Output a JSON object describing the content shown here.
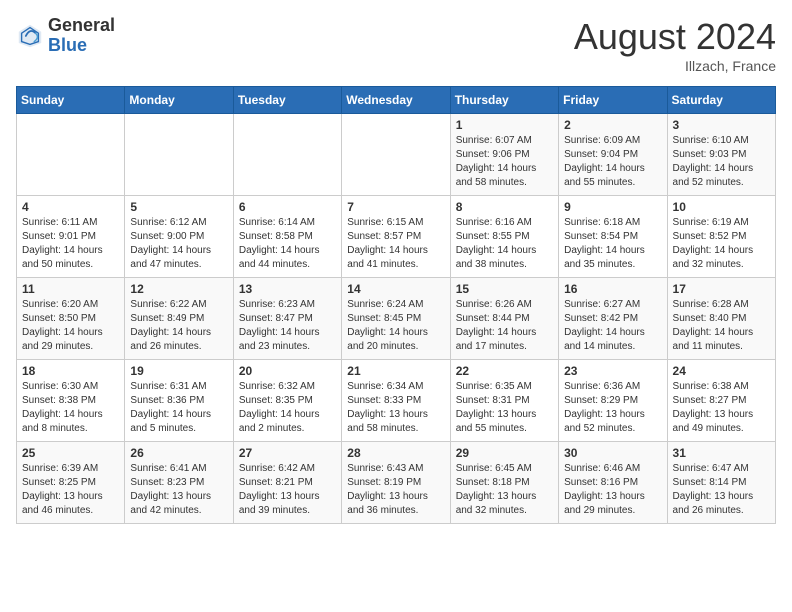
{
  "header": {
    "logo_general": "General",
    "logo_blue": "Blue",
    "month_title": "August 2024",
    "subtitle": "Illzach, France"
  },
  "days_of_week": [
    "Sunday",
    "Monday",
    "Tuesday",
    "Wednesday",
    "Thursday",
    "Friday",
    "Saturday"
  ],
  "weeks": [
    [
      {
        "day": "",
        "info": ""
      },
      {
        "day": "",
        "info": ""
      },
      {
        "day": "",
        "info": ""
      },
      {
        "day": "",
        "info": ""
      },
      {
        "day": "1",
        "info": "Sunrise: 6:07 AM\nSunset: 9:06 PM\nDaylight: 14 hours\nand 58 minutes."
      },
      {
        "day": "2",
        "info": "Sunrise: 6:09 AM\nSunset: 9:04 PM\nDaylight: 14 hours\nand 55 minutes."
      },
      {
        "day": "3",
        "info": "Sunrise: 6:10 AM\nSunset: 9:03 PM\nDaylight: 14 hours\nand 52 minutes."
      }
    ],
    [
      {
        "day": "4",
        "info": "Sunrise: 6:11 AM\nSunset: 9:01 PM\nDaylight: 14 hours\nand 50 minutes."
      },
      {
        "day": "5",
        "info": "Sunrise: 6:12 AM\nSunset: 9:00 PM\nDaylight: 14 hours\nand 47 minutes."
      },
      {
        "day": "6",
        "info": "Sunrise: 6:14 AM\nSunset: 8:58 PM\nDaylight: 14 hours\nand 44 minutes."
      },
      {
        "day": "7",
        "info": "Sunrise: 6:15 AM\nSunset: 8:57 PM\nDaylight: 14 hours\nand 41 minutes."
      },
      {
        "day": "8",
        "info": "Sunrise: 6:16 AM\nSunset: 8:55 PM\nDaylight: 14 hours\nand 38 minutes."
      },
      {
        "day": "9",
        "info": "Sunrise: 6:18 AM\nSunset: 8:54 PM\nDaylight: 14 hours\nand 35 minutes."
      },
      {
        "day": "10",
        "info": "Sunrise: 6:19 AM\nSunset: 8:52 PM\nDaylight: 14 hours\nand 32 minutes."
      }
    ],
    [
      {
        "day": "11",
        "info": "Sunrise: 6:20 AM\nSunset: 8:50 PM\nDaylight: 14 hours\nand 29 minutes."
      },
      {
        "day": "12",
        "info": "Sunrise: 6:22 AM\nSunset: 8:49 PM\nDaylight: 14 hours\nand 26 minutes."
      },
      {
        "day": "13",
        "info": "Sunrise: 6:23 AM\nSunset: 8:47 PM\nDaylight: 14 hours\nand 23 minutes."
      },
      {
        "day": "14",
        "info": "Sunrise: 6:24 AM\nSunset: 8:45 PM\nDaylight: 14 hours\nand 20 minutes."
      },
      {
        "day": "15",
        "info": "Sunrise: 6:26 AM\nSunset: 8:44 PM\nDaylight: 14 hours\nand 17 minutes."
      },
      {
        "day": "16",
        "info": "Sunrise: 6:27 AM\nSunset: 8:42 PM\nDaylight: 14 hours\nand 14 minutes."
      },
      {
        "day": "17",
        "info": "Sunrise: 6:28 AM\nSunset: 8:40 PM\nDaylight: 14 hours\nand 11 minutes."
      }
    ],
    [
      {
        "day": "18",
        "info": "Sunrise: 6:30 AM\nSunset: 8:38 PM\nDaylight: 14 hours\nand 8 minutes."
      },
      {
        "day": "19",
        "info": "Sunrise: 6:31 AM\nSunset: 8:36 PM\nDaylight: 14 hours\nand 5 minutes."
      },
      {
        "day": "20",
        "info": "Sunrise: 6:32 AM\nSunset: 8:35 PM\nDaylight: 14 hours\nand 2 minutes."
      },
      {
        "day": "21",
        "info": "Sunrise: 6:34 AM\nSunset: 8:33 PM\nDaylight: 13 hours\nand 58 minutes."
      },
      {
        "day": "22",
        "info": "Sunrise: 6:35 AM\nSunset: 8:31 PM\nDaylight: 13 hours\nand 55 minutes."
      },
      {
        "day": "23",
        "info": "Sunrise: 6:36 AM\nSunset: 8:29 PM\nDaylight: 13 hours\nand 52 minutes."
      },
      {
        "day": "24",
        "info": "Sunrise: 6:38 AM\nSunset: 8:27 PM\nDaylight: 13 hours\nand 49 minutes."
      }
    ],
    [
      {
        "day": "25",
        "info": "Sunrise: 6:39 AM\nSunset: 8:25 PM\nDaylight: 13 hours\nand 46 minutes."
      },
      {
        "day": "26",
        "info": "Sunrise: 6:41 AM\nSunset: 8:23 PM\nDaylight: 13 hours\nand 42 minutes."
      },
      {
        "day": "27",
        "info": "Sunrise: 6:42 AM\nSunset: 8:21 PM\nDaylight: 13 hours\nand 39 minutes."
      },
      {
        "day": "28",
        "info": "Sunrise: 6:43 AM\nSunset: 8:19 PM\nDaylight: 13 hours\nand 36 minutes."
      },
      {
        "day": "29",
        "info": "Sunrise: 6:45 AM\nSunset: 8:18 PM\nDaylight: 13 hours\nand 32 minutes."
      },
      {
        "day": "30",
        "info": "Sunrise: 6:46 AM\nSunset: 8:16 PM\nDaylight: 13 hours\nand 29 minutes."
      },
      {
        "day": "31",
        "info": "Sunrise: 6:47 AM\nSunset: 8:14 PM\nDaylight: 13 hours\nand 26 minutes."
      }
    ]
  ]
}
